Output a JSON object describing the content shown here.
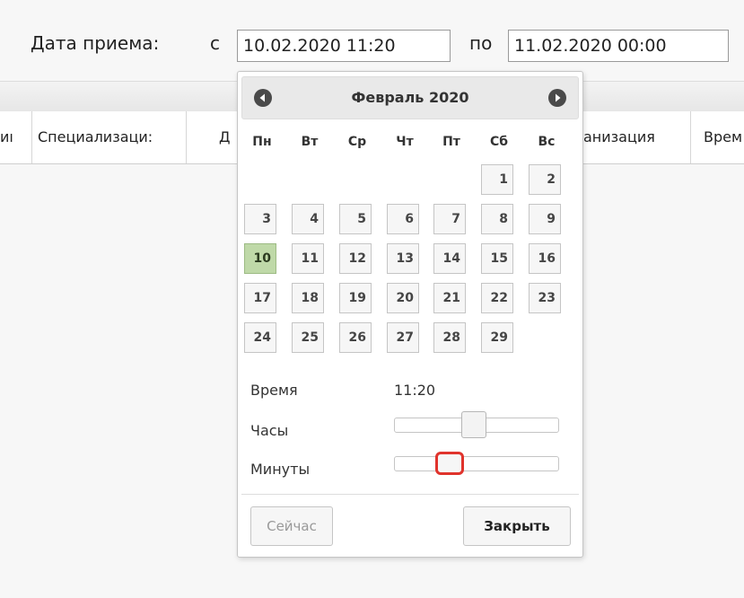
{
  "filter": {
    "date_label": "Дата приема:",
    "from_label": "с",
    "from_value": "10.02.2020 11:20",
    "to_label": "по",
    "to_value": "11.02.2020 00:00"
  },
  "grid": {
    "columns": [
      "иı",
      "Специализаци:",
      "Д",
      "анизация",
      "Врем"
    ]
  },
  "datepicker": {
    "title": "Февраль 2020",
    "weekdays": [
      "Пн",
      "Вт",
      "Ср",
      "Чт",
      "Пт",
      "Сб",
      "Вс"
    ],
    "selected_day": "10",
    "weeks": [
      [
        "",
        "",
        "",
        "",
        "",
        "1",
        "2"
      ],
      [
        "3",
        "4",
        "5",
        "6",
        "7",
        "8",
        "9"
      ],
      [
        "10",
        "11",
        "12",
        "13",
        "14",
        "15",
        "16"
      ],
      [
        "17",
        "18",
        "19",
        "20",
        "21",
        "22",
        "23"
      ],
      [
        "24",
        "25",
        "26",
        "27",
        "28",
        "29",
        ""
      ]
    ],
    "time_label": "Время",
    "time_value": "11:20",
    "hours_label": "Часы",
    "minutes_label": "Минуты",
    "hours_slider_fraction": 0.48,
    "minutes_slider_fraction": 0.33,
    "now_button": "Сейчас",
    "close_button": "Закрыть"
  },
  "icons": {
    "prev": "circle-triangle-left-icon",
    "next": "circle-triangle-right-icon"
  },
  "colors": {
    "selected_day_bg": "#bfd9a8",
    "focus_outline": "#e0332c"
  }
}
